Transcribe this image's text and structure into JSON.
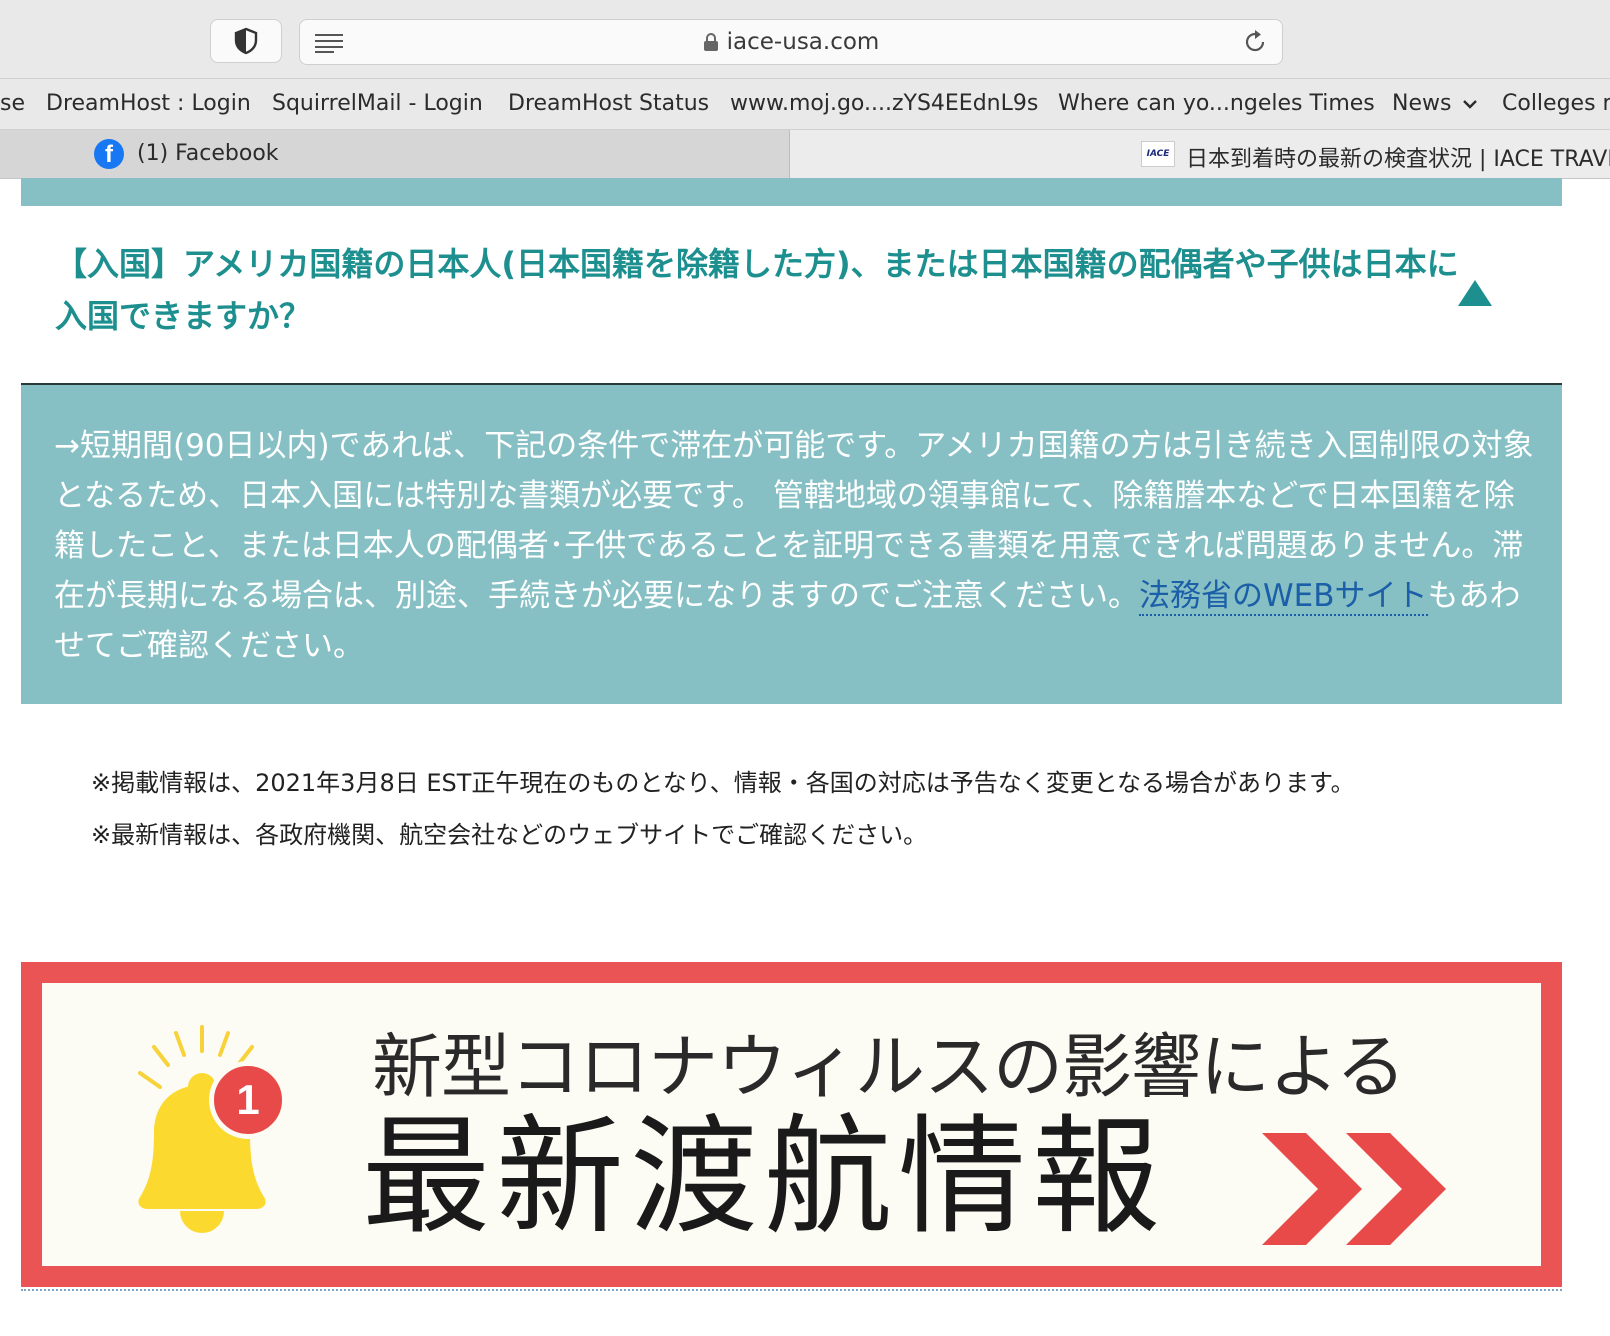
{
  "browser": {
    "url": "iace-usa.com",
    "bookmarks": [
      "se",
      "DreamHost : Login",
      "SquirrelMail - Login",
      "DreamHost Status",
      "www.moj.go....zYS4EEdnL9s",
      "Where can yo...ngeles Times",
      "News",
      "Colleges n"
    ],
    "tabs": [
      {
        "label": "(1) Facebook",
        "icon": "facebook-icon",
        "active": false
      },
      {
        "label": "日本到着時の最新の検査状況 | IACE TRAVEL",
        "icon": "iace-favicon",
        "favicon_text": "IACE",
        "active": true
      }
    ]
  },
  "faq": {
    "question": "【入国】アメリカ国籍の日本人(日本国籍を除籍した方)、または日本国籍の配偶者や子供は日本に入国できますか？",
    "answer_before_link": "→短期間(90日以内)であれば、下記の条件で滞在が可能です。アメリカ国籍の方は引き続き入国制限の対象となるため、日本入国には特別な書類が必要です。 管轄地域の領事館にて、除籍謄本などで日本国籍を除籍したこと、または日本人の配偶者･子供であることを証明できる書類を用意できれば問題ありません。滞在が長期になる場合は、別途、手続きが必要になりますのでご注意ください。",
    "answer_link": "法務省のWEBサイト",
    "answer_after_link": "もあわせてご確認ください。"
  },
  "notes": [
    "※掲載情報は、2021年3月8日 EST正午現在のものとなり、情報・各国の対応は予告なく変更となる場合があります。",
    "※最新情報は、各政府機関、航空会社などのウェブサイトでご確認ください。"
  ],
  "banner": {
    "line1": "新型コロナウィルスの影響による",
    "line2": "最新渡航情報",
    "badge_count": "1"
  },
  "colors": {
    "teal_bg": "#87c0c4",
    "question_teal": "#1d8f8f",
    "banner_red": "#ea5454",
    "link_blue": "#1a5fa8",
    "bell_yellow": "#fbd92f"
  }
}
